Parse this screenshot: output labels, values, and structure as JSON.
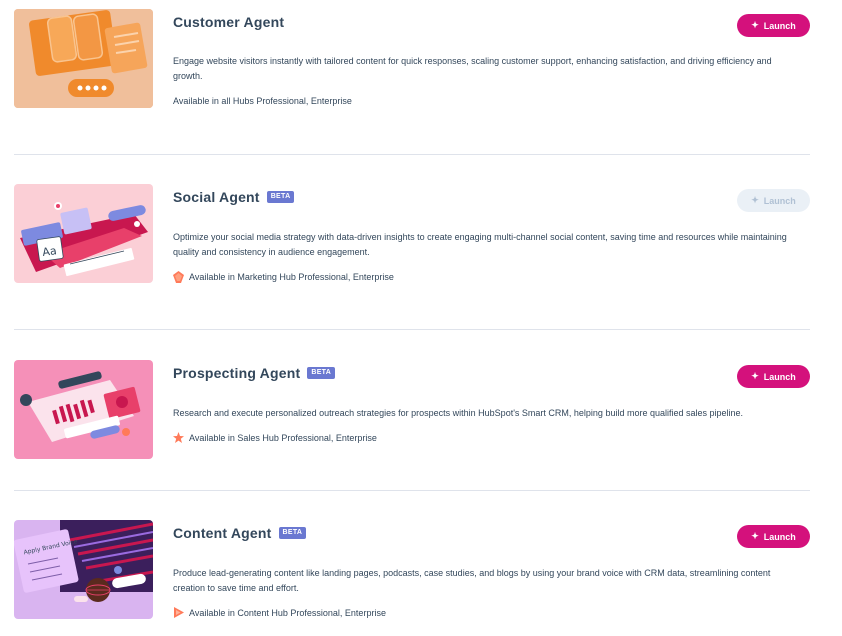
{
  "agents": [
    {
      "title": "Customer Agent",
      "beta": "",
      "description": "Engage website visitors instantly with tailored content for quick responses, scaling customer support, enhancing satisfaction, and driving efficiency and growth.",
      "availability": "Available in all Hubs Professional, Enterprise",
      "launch_label": "Launch",
      "launch_enabled": true
    },
    {
      "title": "Social Agent",
      "beta": "BETA",
      "description": "Optimize your social media strategy with data-driven insights to create engaging multi-channel social content, saving time and resources while maintaining quality and consistency in audience engagement.",
      "availability": "Available in Marketing Hub Professional, Enterprise",
      "launch_label": "Launch",
      "launch_enabled": false,
      "thumb_text": "Aa"
    },
    {
      "title": "Prospecting Agent",
      "beta": "BETA",
      "description": "Research and execute personalized outreach strategies for prospects within HubSpot's Smart CRM, helping build more qualified sales pipeline.",
      "availability": "Available in Sales Hub Professional, Enterprise",
      "launch_label": "Launch",
      "launch_enabled": true
    },
    {
      "title": "Content Agent",
      "beta": "BETA",
      "description": "Produce lead-generating content like landing pages, podcasts, case studies, and blogs by using your brand voice with CRM data, streamlining content creation to save time and effort.",
      "availability": "Available in Content Hub Professional, Enterprise",
      "launch_label": "Launch",
      "launch_enabled": true,
      "thumb_text": "Apply Brand Voice"
    }
  ],
  "colors": {
    "launch": "#d4117c",
    "beta": "#6a78d1",
    "text": "#33475b",
    "divider": "#dfe3eb"
  },
  "icons": {
    "launch": "sparkle-icon",
    "hub_all": "none",
    "hub_marketing": "marketing-hub-icon",
    "hub_sales": "sales-hub-icon",
    "hub_content": "content-hub-icon"
  }
}
